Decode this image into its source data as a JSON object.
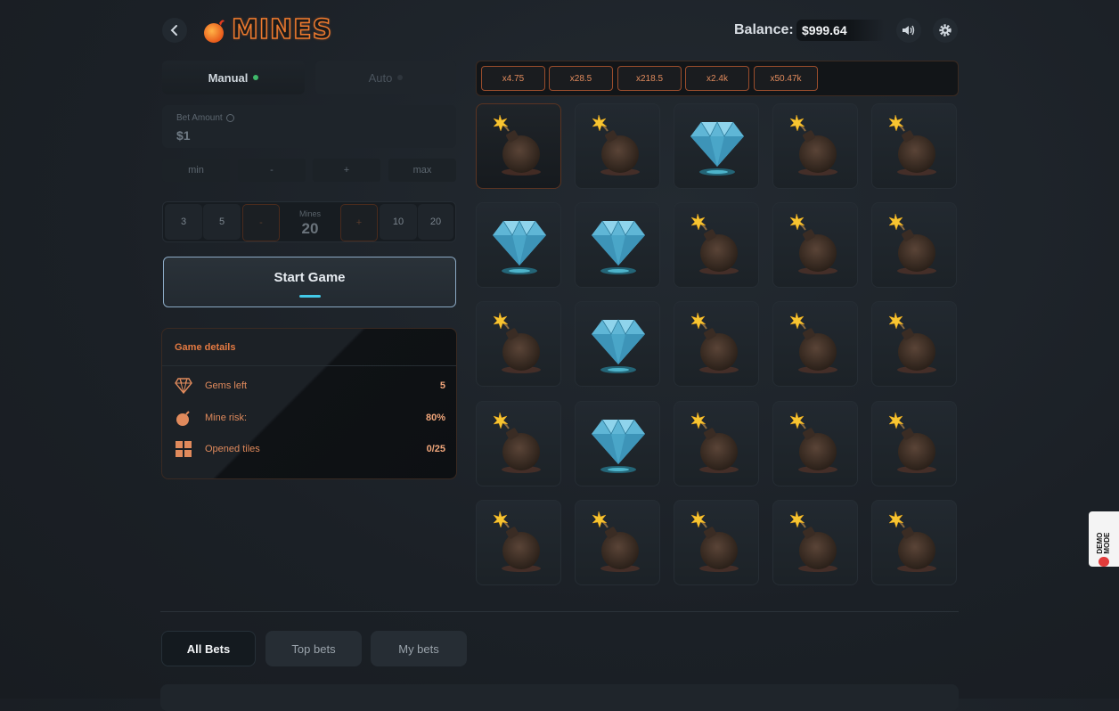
{
  "header": {
    "back_icon": "chevron-left-icon",
    "logo_text": "MINES",
    "logo_icon": "bomb-flame-icon",
    "balance_label": "Balance:",
    "balance_value": "$999.64",
    "sound_icon": "speaker-icon",
    "settings_icon": "gear-icon"
  },
  "mode_tabs": [
    {
      "label": "Manual",
      "active": true,
      "dot_color": "#3fb86a"
    },
    {
      "label": "Auto",
      "active": false
    }
  ],
  "bet": {
    "label": "Bet Amount",
    "info_icon": "info-icon",
    "value": "$1",
    "steps": [
      "min",
      "-",
      "+",
      "max"
    ]
  },
  "mines": {
    "presets_left": [
      "3",
      "5"
    ],
    "decrement": "-",
    "label": "Mines",
    "value": "20",
    "increment": "+",
    "presets_right": [
      "10",
      "20"
    ]
  },
  "start_button": "Start Game",
  "game_details": {
    "title": "Game details",
    "rows": [
      {
        "icon": "gem-icon",
        "label": "Gems left",
        "value": "5"
      },
      {
        "icon": "bomb-icon",
        "label": "Mine risk:",
        "value": "80%"
      },
      {
        "icon": "grid-icon",
        "label": "Opened tiles",
        "value": "0/25"
      }
    ]
  },
  "multipliers": [
    "x4.75",
    "x28.5",
    "x218.5",
    "x2.4k",
    "x50.47k"
  ],
  "grid": [
    [
      "bomb",
      "bomb",
      "gem",
      "bomb",
      "bomb"
    ],
    [
      "gem",
      "gem",
      "bomb",
      "bomb",
      "bomb"
    ],
    [
      "bomb",
      "gem",
      "bomb",
      "bomb",
      "bomb"
    ],
    [
      "bomb",
      "gem",
      "bomb",
      "bomb",
      "bomb"
    ],
    [
      "bomb",
      "bomb",
      "bomb",
      "bomb",
      "bomb"
    ]
  ],
  "selected_tile": {
    "row": 0,
    "col": 0
  },
  "bets_tabs": [
    {
      "label": "All Bets",
      "active": true
    },
    {
      "label": "Top bets",
      "active": false
    },
    {
      "label": "My bets",
      "active": false
    }
  ],
  "demo_badge": "DEMO MODE",
  "colors": {
    "accent": "#e47a42",
    "gem": "#43c9e8",
    "start_border": "#8ba9c4"
  }
}
